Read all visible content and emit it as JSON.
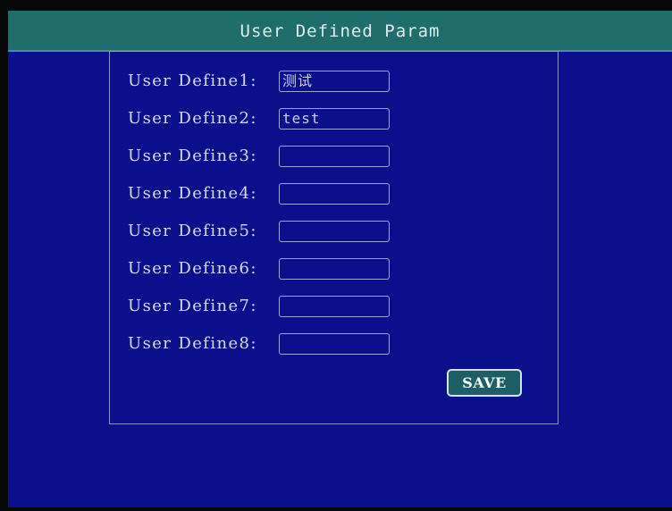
{
  "window": {
    "title": "User Defined Param"
  },
  "form": {
    "fields": [
      {
        "label": "User Define1:",
        "value": "测试"
      },
      {
        "label": "User Define2:",
        "value": "test"
      },
      {
        "label": "User Define3:",
        "value": ""
      },
      {
        "label": "User Define4:",
        "value": ""
      },
      {
        "label": "User Define5:",
        "value": ""
      },
      {
        "label": "User Define6:",
        "value": ""
      },
      {
        "label": "User Define7:",
        "value": ""
      },
      {
        "label": "User Define8:",
        "value": ""
      }
    ],
    "save_label": "SAVE"
  },
  "colors": {
    "background": "#0a0f8c",
    "titlebar": "#1f6d6c",
    "button": "#1c5f66",
    "text": "#d8dcef"
  }
}
